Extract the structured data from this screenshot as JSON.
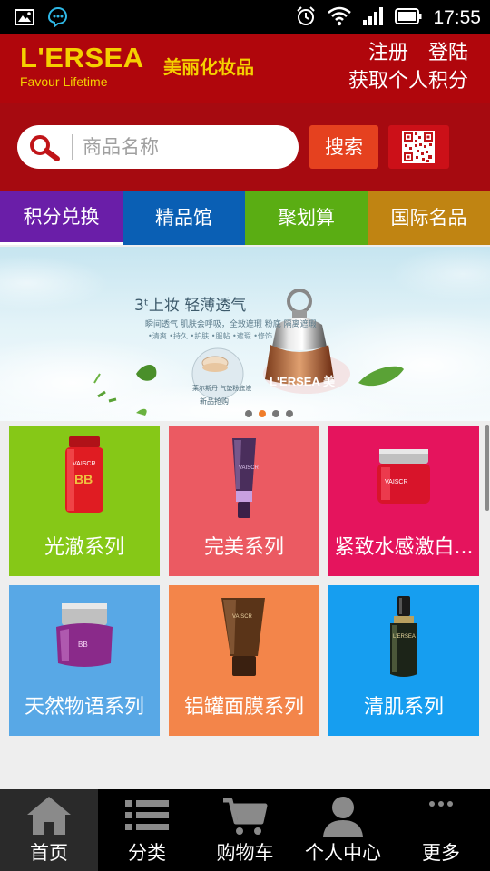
{
  "status_bar": {
    "time": "17:55"
  },
  "header": {
    "brand": "L'ERSEA",
    "brand_cn": "美丽化妆品",
    "tagline": "Favour Lifetime",
    "register": "注册",
    "login": "登陆",
    "points": "获取个人积分"
  },
  "search": {
    "placeholder": "商品名称",
    "button": "搜索"
  },
  "nav_tabs": [
    {
      "label": "积分兑换",
      "color": "#6a1ea8"
    },
    {
      "label": "精品馆",
      "color": "#0a5fb4"
    },
    {
      "label": "聚划算",
      "color": "#5aad13"
    },
    {
      "label": "国际名品",
      "color": "#c08412"
    }
  ],
  "banner": {
    "headline": "3ᵗ上妆 轻薄透气",
    "sub1": "瞬间透气 肌肤会呼吸，全效遮瑕 粉底 隔离遮瑕",
    "sub2": "•清爽 •持久 •护肤 •服帖 •遮瑕 •修饰",
    "brand": "L'ERSEA 美",
    "tag": "莱尔斯丹 气垫粉底液",
    "tag2": "新品抢购",
    "dots": 4,
    "active_dot": 1
  },
  "categories": [
    {
      "label": "光澈系列",
      "color": "#86c817",
      "product": "bb-bottle"
    },
    {
      "label": "完美系列",
      "color": "#eb5a62",
      "product": "tube-purple"
    },
    {
      "label": "紧致水感激白...",
      "color": "#e5145d",
      "product": "jar-red"
    },
    {
      "label": "天然物语系列",
      "color": "#58a8e6",
      "product": "jar-purple"
    },
    {
      "label": "铝罐面膜系列",
      "color": "#f3854a",
      "product": "tube-brown"
    },
    {
      "label": "清肌系列",
      "color": "#169ef0",
      "product": "serum-bottle"
    }
  ],
  "bottom_nav": [
    {
      "label": "首页",
      "icon": "home-icon",
      "active": true
    },
    {
      "label": "分类",
      "icon": "list-icon",
      "active": false
    },
    {
      "label": "购物车",
      "icon": "cart-icon",
      "active": false
    },
    {
      "label": "个人中心",
      "icon": "user-icon",
      "active": false
    },
    {
      "label": "更多",
      "icon": "more-icon",
      "active": false
    }
  ]
}
